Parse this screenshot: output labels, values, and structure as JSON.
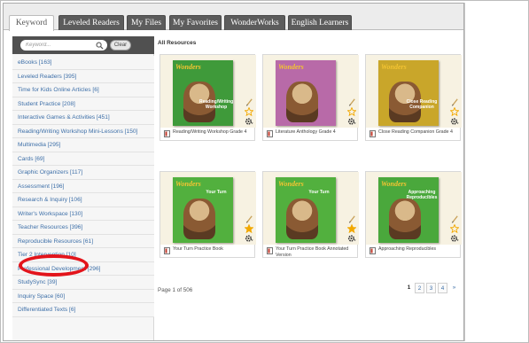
{
  "tabs": [
    {
      "label": "Keyword",
      "active": true
    },
    {
      "label": "Leveled Readers",
      "active": false
    },
    {
      "label": "My Files",
      "active": false
    },
    {
      "label": "My Favorites",
      "active": false
    },
    {
      "label": "WonderWorks",
      "active": false
    },
    {
      "label": "English Learners",
      "active": false
    }
  ],
  "search": {
    "placeholder": "Keyword...",
    "clear_label": "Clear"
  },
  "categories": [
    "eBooks [163]",
    "Leveled Readers [395]",
    "Time for Kids Online Articles [6]",
    "Student Practice [208]",
    "Interactive Games & Activities [451]",
    "Reading/Writing Workshop Mini-Lessons [150]",
    "Multimedia [295]",
    "Cards [69]",
    "Graphic Organizers [117]",
    "Assessment [196]",
    "Research & Inquiry [106]",
    "Writer's Workspace [130]",
    "Teacher Resources [396]",
    "Reproducible Resources [61]",
    "Tier 2 Intervention [10]",
    "Professional Development [296]",
    "StudySync [39]",
    "Inquiry Space [60]",
    "Differentiated Texts [6]"
  ],
  "main": {
    "title": "All Resources",
    "resources": [
      {
        "caption": "Reading/Writing Workshop Grade 4",
        "logo": "Wonders",
        "band": "Reading/Writing Workshop",
        "cover_color": "#3f9a3a",
        "favorite": false
      },
      {
        "caption": "Literature Anthology Grade 4",
        "logo": "Wonders",
        "band": "",
        "cover_color": "#b86aa8",
        "favorite": false
      },
      {
        "caption": "Close Reading Companion Grade 4",
        "logo": "Wonders",
        "band": "Close Reading Companion",
        "cover_color": "#c9a62a",
        "favorite": false
      },
      {
        "caption": "Your Turn Practice Book",
        "logo": "Wonders",
        "band": "Your Turn",
        "cover_color": "#52b03e",
        "favorite": true
      },
      {
        "caption": "Your Turn Practice Book Annotated Version",
        "logo": "Wonders",
        "band": "Your Turn",
        "cover_color": "#52b03e",
        "favorite": true
      },
      {
        "caption": "Approaching Reproducibles",
        "logo": "Wonders",
        "band": "Approaching Reproducibles",
        "cover_color": "#4aa83c",
        "favorite": false
      }
    ]
  },
  "pager": {
    "label": "Page 1 of 506",
    "pages": [
      "1",
      "2",
      "3",
      "4"
    ],
    "current": "1",
    "next": "»"
  },
  "colors": {
    "tab_dark": "#5c5c5c",
    "link": "#3d6fa8",
    "highlight": "#e3141b",
    "star": "#f2a800"
  }
}
